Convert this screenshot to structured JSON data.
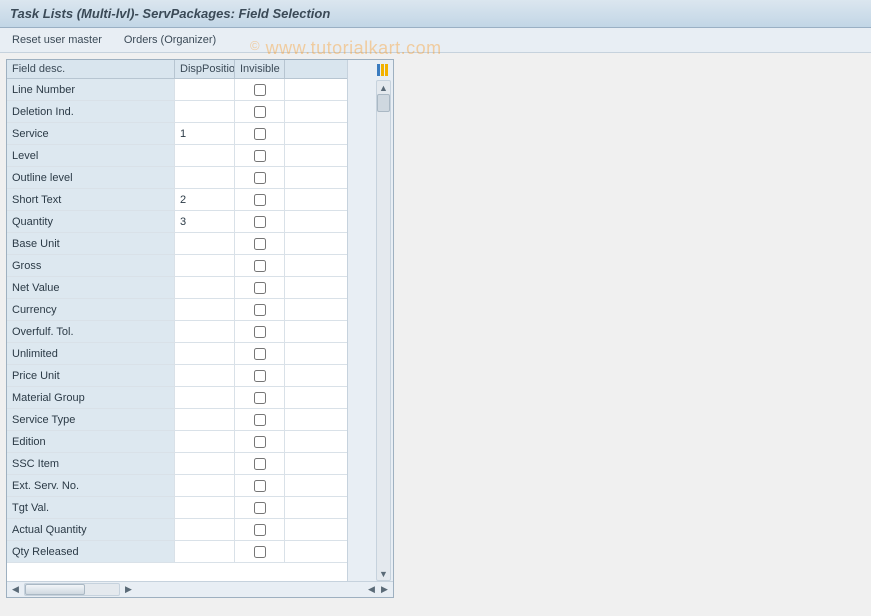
{
  "title": "Task Lists (Multi-lvl)- ServPackages: Field Selection",
  "toolbar": {
    "reset_label": "Reset user master",
    "orders_label": "Orders (Organizer)"
  },
  "watermark": "www.tutorialkart.com",
  "table": {
    "headers": {
      "desc": "Field desc.",
      "disp": "DispPosition",
      "inv": "Invisible"
    },
    "rows": [
      {
        "desc": "Line Number",
        "disp": "",
        "inv": false
      },
      {
        "desc": "Deletion Ind.",
        "disp": "",
        "inv": false
      },
      {
        "desc": "Service",
        "disp": "1",
        "inv": false
      },
      {
        "desc": "Level",
        "disp": "",
        "inv": false
      },
      {
        "desc": "Outline level",
        "disp": "",
        "inv": false
      },
      {
        "desc": "Short Text",
        "disp": "2",
        "inv": false
      },
      {
        "desc": "Quantity",
        "disp": "3",
        "inv": false
      },
      {
        "desc": "Base Unit",
        "disp": "",
        "inv": false
      },
      {
        "desc": "Gross",
        "disp": "",
        "inv": false
      },
      {
        "desc": "Net Value",
        "disp": "",
        "inv": false
      },
      {
        "desc": "Currency",
        "disp": "",
        "inv": false
      },
      {
        "desc": "Overfulf. Tol.",
        "disp": "",
        "inv": false
      },
      {
        "desc": "Unlimited",
        "disp": "",
        "inv": false
      },
      {
        "desc": "Price Unit",
        "disp": "",
        "inv": false
      },
      {
        "desc": "Material Group",
        "disp": "",
        "inv": false
      },
      {
        "desc": "Service Type",
        "disp": "",
        "inv": false
      },
      {
        "desc": "Edition",
        "disp": "",
        "inv": false
      },
      {
        "desc": "SSC Item",
        "disp": "",
        "inv": false
      },
      {
        "desc": "Ext. Serv. No.",
        "disp": "",
        "inv": false
      },
      {
        "desc": "Tgt Val.",
        "disp": "",
        "inv": false
      },
      {
        "desc": "Actual Quantity",
        "disp": "",
        "inv": false
      },
      {
        "desc": "Qty Released",
        "disp": "",
        "inv": false
      }
    ]
  }
}
